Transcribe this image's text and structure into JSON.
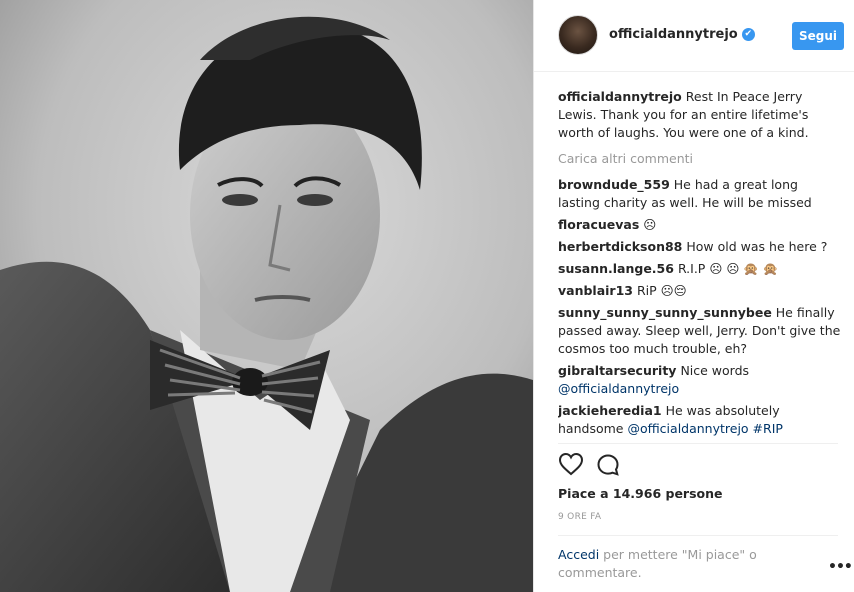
{
  "post": {
    "username": "officialdannytrejo",
    "verified_glyph": "✔",
    "follow_label": "Segui",
    "caption_text": "Rest In Peace Jerry Lewis. Thank you for an entire lifetime's worth of laughs. You were one of a kind.",
    "load_more_label": "Carica altri commenti",
    "comments": [
      {
        "user": "browndude_559",
        "text": "He had a great long lasting charity as well. He will be missed"
      },
      {
        "user": "floracuevas",
        "text": "☹"
      },
      {
        "user": "herbertdickson88",
        "text": "How old was he here ?"
      },
      {
        "user": "susann.lange.56",
        "text": "R.I.P ☹ ☹ 🙊 🙊"
      },
      {
        "user": "vanblair13",
        "text": "RiP ☹😔"
      },
      {
        "user": "sunny_sunny_sunny_sunnybee",
        "text": "He finally passed away. Sleep well, Jerry. Don't give the cosmos too much trouble, eh?"
      },
      {
        "user": "gibraltarsecurity",
        "text": "Nice words",
        "mention": "@officialdannytrejo"
      },
      {
        "user": "jackieheredia1",
        "text": "He was absolutely handsome",
        "mention": "@officialdannytrejo #RIP"
      }
    ],
    "likes_label": "Piace a 14.966 persone",
    "timestamp": "9 ORE FA",
    "footer": {
      "login_link": "Accedi",
      "rest": " per mettere \"Mi piace\" o commentare."
    },
    "more_label": "•••"
  },
  "icons": {
    "heart": "heart-icon",
    "comment": "comment-icon",
    "verified": "verified-badge-icon",
    "more": "more-options-icon"
  },
  "colors": {
    "accent": "#3897f0",
    "link": "#003569",
    "muted": "#999999",
    "text": "#262626"
  }
}
